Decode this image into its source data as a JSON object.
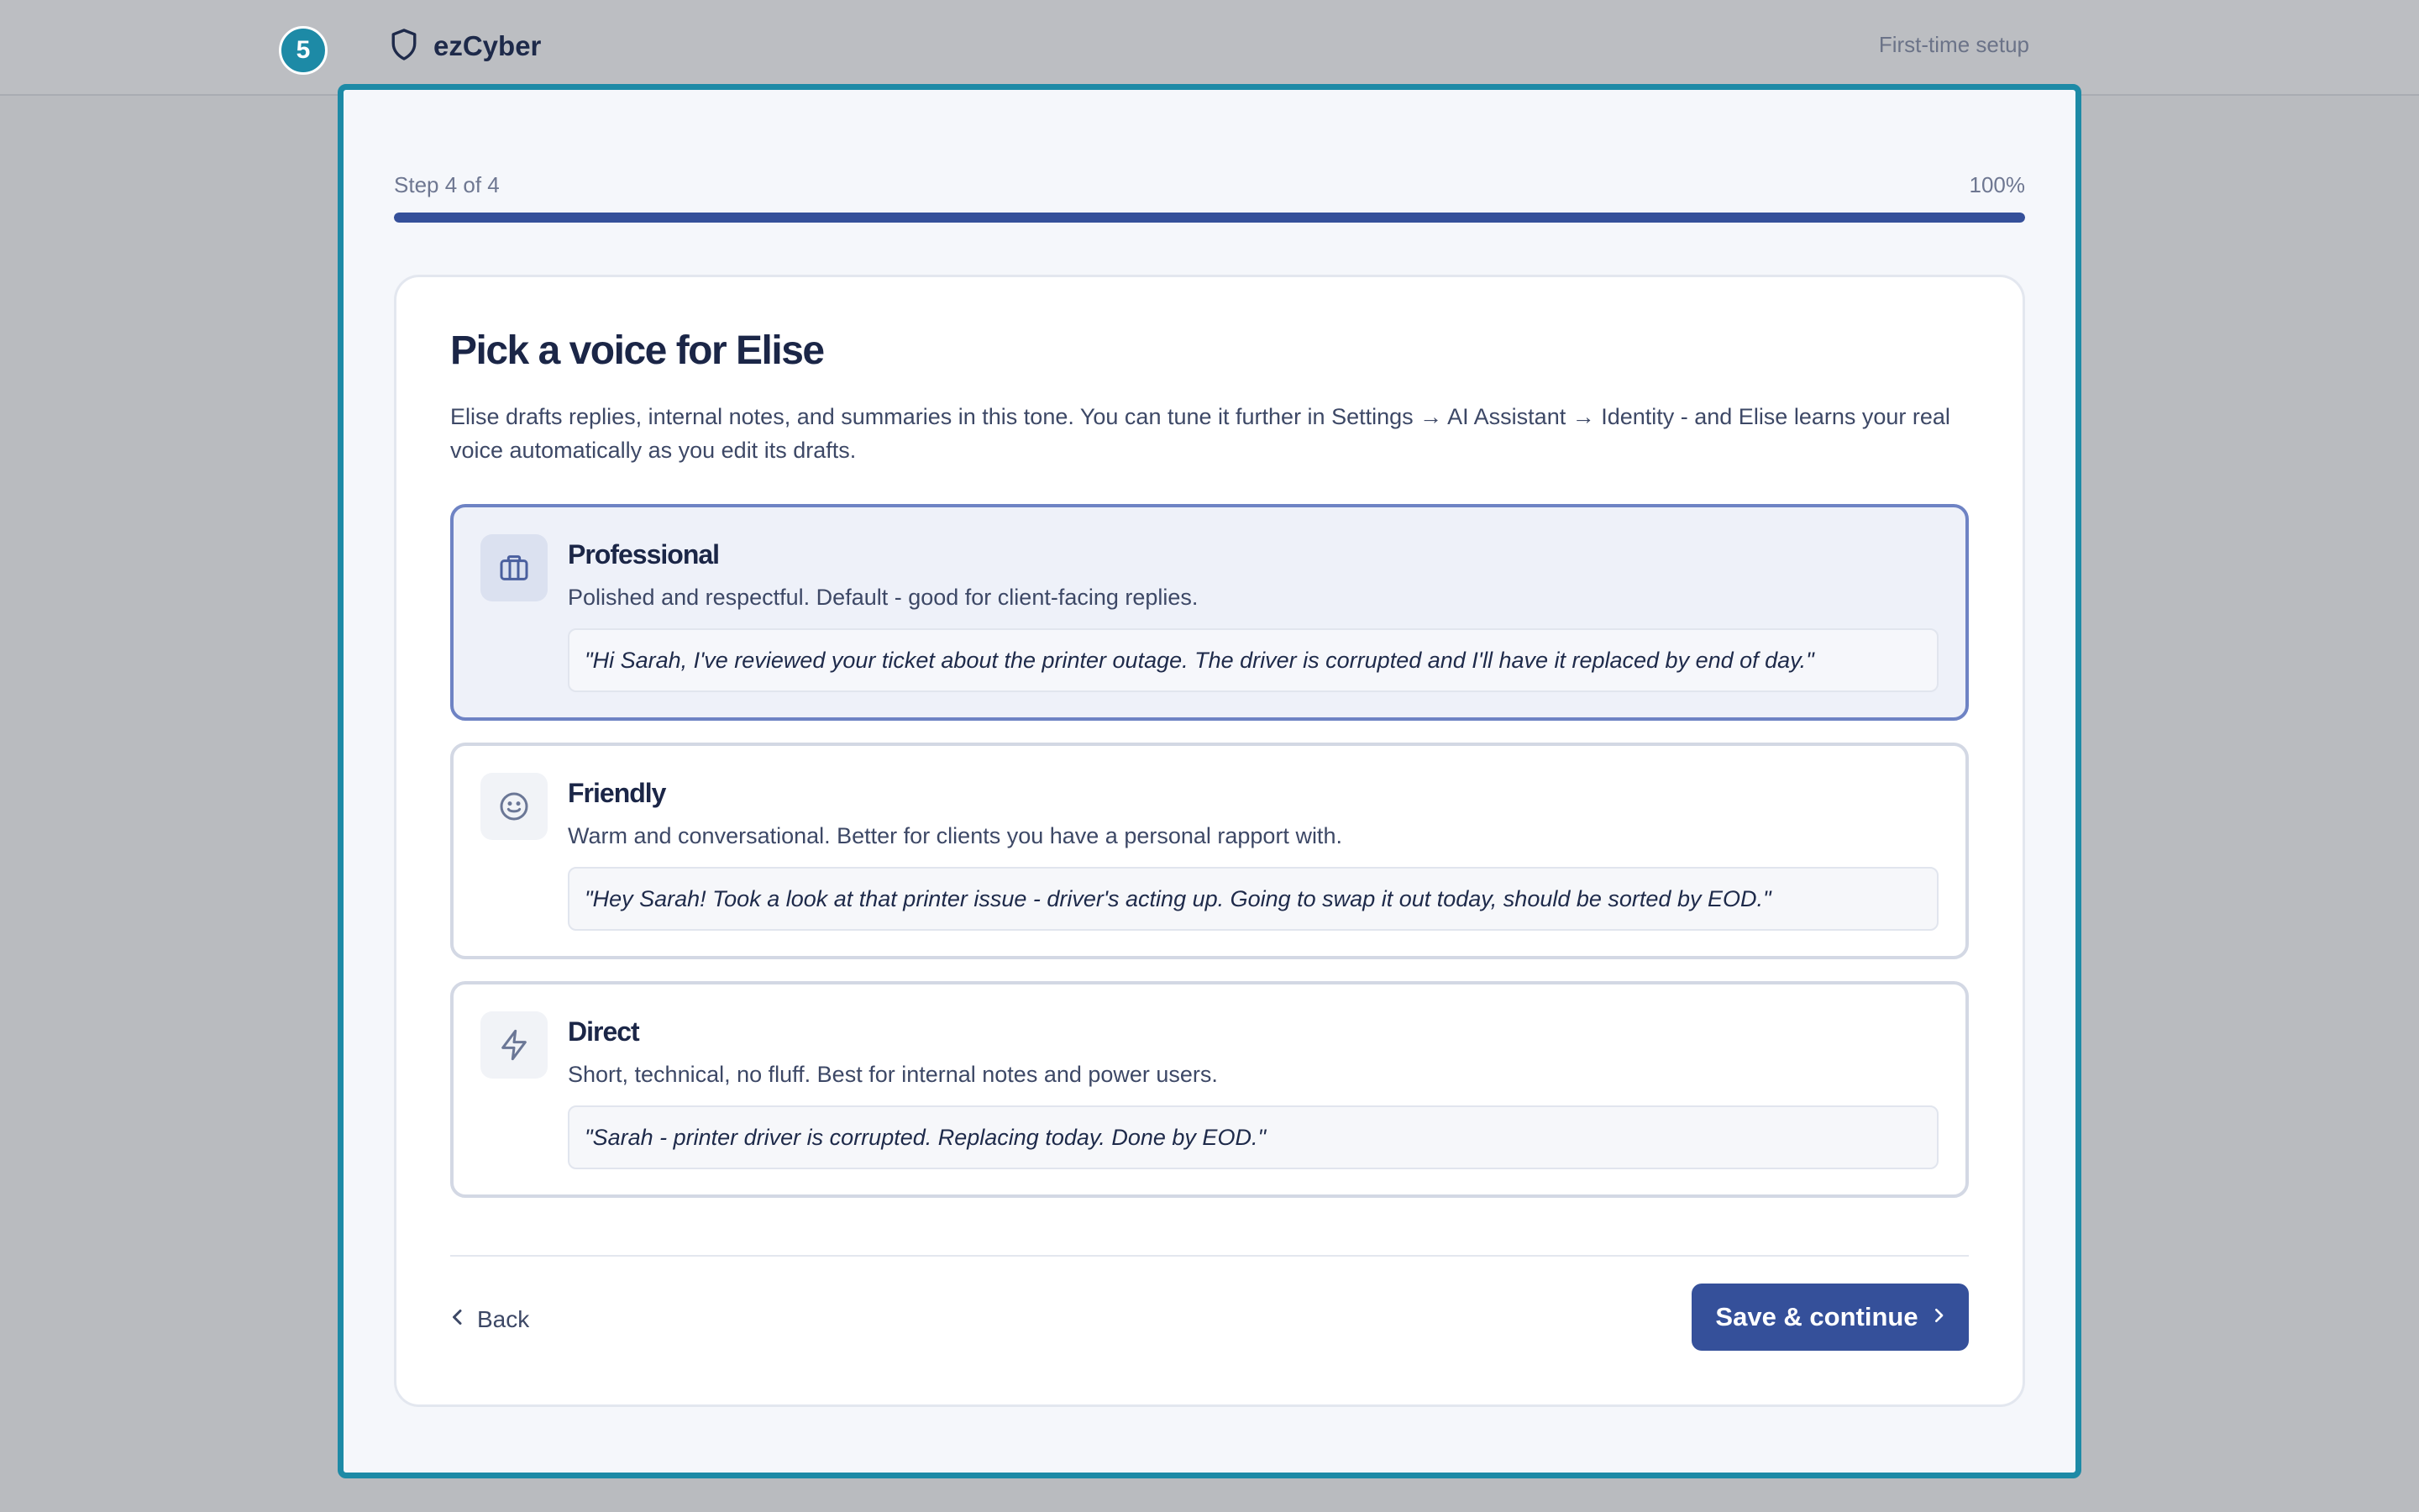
{
  "step_badge": "5",
  "brand": {
    "name": "ezCyber",
    "icon": "shield-icon"
  },
  "header": {
    "setup_link": "First-time setup"
  },
  "progress": {
    "label": "Step 4 of 4",
    "percent_label": "100%",
    "fraction": 1.0
  },
  "wizard": {
    "title": "Pick a voice for Elise",
    "description": "Elise drafts replies, internal notes, and summaries in this tone. You can tune it further in Settings → AI Assistant → Identity - and Elise learns your real voice automatically as you edit its drafts.",
    "options": [
      {
        "title": "Professional",
        "subtitle": "Polished and respectful. Default - good for client-facing replies.",
        "example": "\"Hi Sarah, I've reviewed your ticket about the printer outage. The driver is corrupted and I'll have it replaced by end of day.\"",
        "icon": "briefcase-icon",
        "selected": true
      },
      {
        "title": "Friendly",
        "subtitle": "Warm and conversational. Better for clients you have a personal rapport with.",
        "example": "\"Hey Sarah! Took a look at that printer issue - driver's acting up. Going to swap it out today, should be sorted by EOD.\"",
        "icon": "smiley-icon",
        "selected": false
      },
      {
        "title": "Direct",
        "subtitle": "Short, technical, no fluff. Best for internal notes and power users.",
        "example": "\"Sarah - printer driver is corrupted. Replacing today. Done by EOD.\"",
        "icon": "lightning-icon",
        "selected": false
      }
    ],
    "back_label": "Back",
    "save_label": "Save & continue"
  },
  "colors": {
    "accent": "#35509a",
    "frame": "#1d8aa6",
    "selected_border": "#6e83c4",
    "selected_bg": "#eef1f9"
  }
}
